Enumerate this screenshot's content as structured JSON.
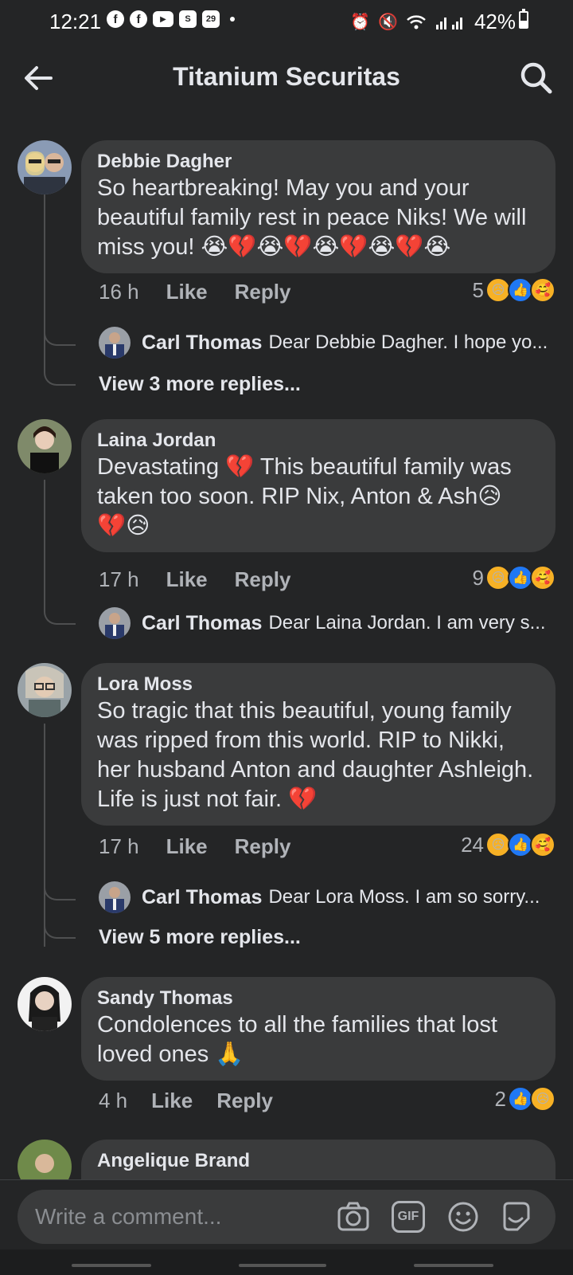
{
  "status_bar": {
    "time": "12:21",
    "battery": "42%",
    "calendar_day": "29"
  },
  "header": {
    "title": "Titanium Securitas"
  },
  "comments": [
    {
      "author": "Debbie Dagher",
      "text": "So heartbreaking! May you and your beautiful family rest in peace Niks! We will miss you! 😭💔😭💔😭💔😭💔😭",
      "time": "16 h",
      "like_label": "Like",
      "reply_label": "Reply",
      "reaction_count": "5",
      "reply": {
        "author": "Carl Thomas",
        "text": "Dear Debbie Dagher. I hope yo..."
      },
      "more_replies": "View 3 more replies..."
    },
    {
      "author": "Laina Jordan",
      "text": "Devastating 💔 This beautiful family was taken too soon. RIP Nix, Anton & Ash😥\n💔😥",
      "time": "17 h",
      "like_label": "Like",
      "reply_label": "Reply",
      "reaction_count": "9",
      "reply": {
        "author": "Carl Thomas",
        "text": "Dear Laina Jordan. I am very s..."
      }
    },
    {
      "author": "Lora Moss",
      "text": "So tragic that this beautiful, young family was ripped from this world. RIP to Nikki, her husband Anton and daughter Ashleigh. Life is just not fair. 💔",
      "time": "17 h",
      "like_label": "Like",
      "reply_label": "Reply",
      "reaction_count": "24",
      "reply": {
        "author": "Carl Thomas",
        "text": "Dear Lora Moss. I am so sorry..."
      },
      "more_replies": "View 5 more replies..."
    },
    {
      "author": "Sandy Thomas",
      "text": "Condolences to all the families that lost loved ones 🙏",
      "time": "4 h",
      "like_label": "Like",
      "reply_label": "Reply",
      "reaction_count": "2"
    },
    {
      "author": "Angelique Brand"
    }
  ],
  "composer": {
    "placeholder": "Write a comment...",
    "gif_label": "GIF"
  },
  "colors": {
    "background": "#242526",
    "bubble": "#3a3b3c",
    "like_blue": "#2078f4",
    "reaction_yellow": "#f7b125"
  }
}
